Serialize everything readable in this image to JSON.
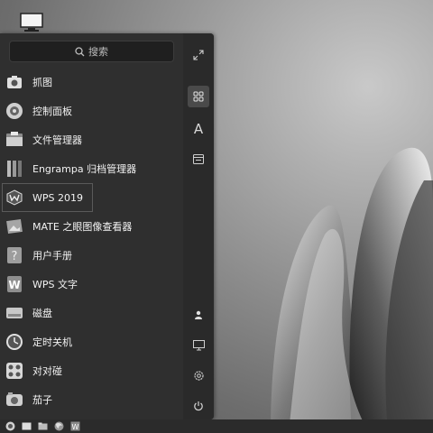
{
  "search": {
    "placeholder": "搜索"
  },
  "apps": [
    {
      "label": "抓图",
      "icon": "screenshot-icon"
    },
    {
      "label": "控制面板",
      "icon": "control-panel-icon"
    },
    {
      "label": "文件管理器",
      "icon": "file-manager-icon"
    },
    {
      "label": "Engrampa 归档管理器",
      "icon": "archive-manager-icon"
    },
    {
      "label": "WPS 2019",
      "icon": "wps-icon"
    },
    {
      "label": "MATE 之眼图像查看器",
      "icon": "image-viewer-icon"
    },
    {
      "label": "用户手册",
      "icon": "help-icon"
    },
    {
      "label": "WPS 文字",
      "icon": "wps-writer-icon"
    },
    {
      "label": "磁盘",
      "icon": "disk-icon"
    },
    {
      "label": "定时关机",
      "icon": "timed-shutdown-icon"
    },
    {
      "label": "对对碰",
      "icon": "game-icon"
    },
    {
      "label": "茄子",
      "icon": "camera-app-icon"
    }
  ],
  "sidebar": {
    "icons": [
      "expand-icon",
      "all-apps-icon",
      "letter-sort-icon",
      "category-icon",
      "user-icon",
      "computer-icon",
      "settings-icon",
      "power-icon"
    ],
    "letter": "A"
  }
}
